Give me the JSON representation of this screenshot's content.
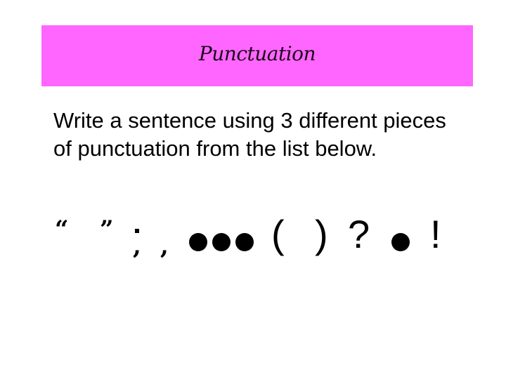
{
  "slide": {
    "title": "Punctuation",
    "instruction": "Write a sentence using 3 different pieces of punctuation from the list below.",
    "colors": {
      "banner": "#ff66ff",
      "text": "#000000"
    },
    "punctuation": {
      "open_quote": "“",
      "close_quote": "”",
      "semicolon_dot": "▪",
      "semicolon_comma": ",",
      "comma": ",",
      "ellipsis": "●●●",
      "open_paren": "(",
      "close_paren": ")",
      "question_mark": "?",
      "full_stop": "●",
      "exclamation_mark": "!"
    }
  }
}
